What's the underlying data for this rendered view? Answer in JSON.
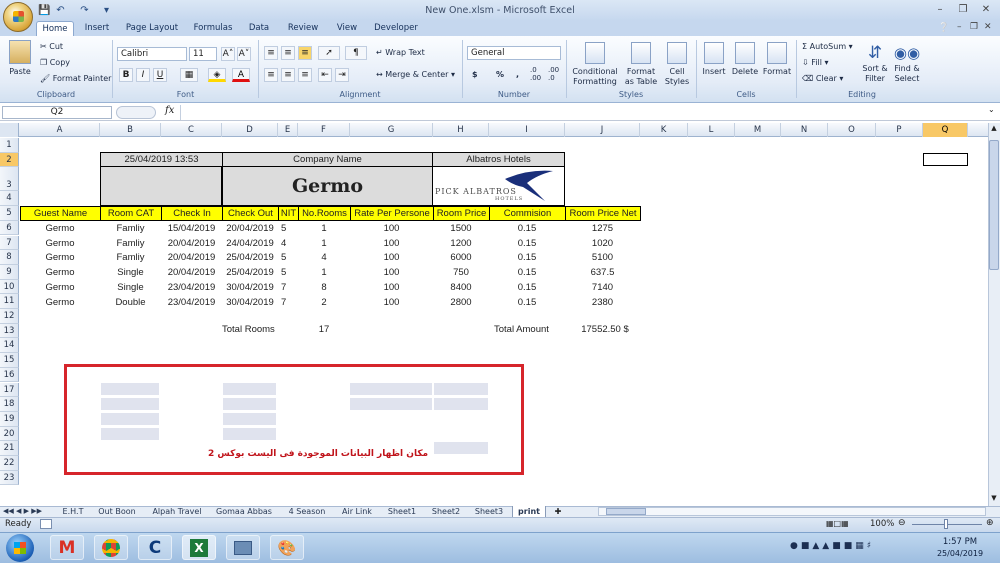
{
  "window": {
    "title": "New One.xlsm - Microsoft Excel"
  },
  "quick_access": [
    "save",
    "undo",
    "redo"
  ],
  "ribbon_tabs": [
    "Home",
    "Insert",
    "Page Layout",
    "Formulas",
    "Data",
    "Review",
    "View",
    "Developer"
  ],
  "ribbon": {
    "clipboard": {
      "label": "Clipboard",
      "paste": "Paste",
      "cut": "Cut",
      "copy": "Copy",
      "painter": "Format Painter"
    },
    "font": {
      "label": "Font",
      "name": "Calibri",
      "size": "11",
      "bold": "B",
      "italic": "I",
      "underline": "U",
      "grow": "A˄",
      "shrink": "A˅",
      "fontcolor": "A"
    },
    "alignment": {
      "label": "Alignment",
      "wrap": "Wrap Text",
      "merge": "Merge & Center"
    },
    "number": {
      "label": "Number",
      "format": "General",
      "currency": "$",
      "percent": "%",
      "comma": ",",
      "inc": ".0 .00",
      "dec": ".00 .0"
    },
    "styles": {
      "label": "Styles",
      "cond": "Conditional Formatting",
      "table": "Format as Table",
      "cell": "Cell Styles"
    },
    "cells": {
      "label": "Cells",
      "insert": "Insert",
      "delete": "Delete",
      "format": "Format"
    },
    "editing": {
      "label": "Editing",
      "autosum": "AutoSum",
      "fill": "Fill",
      "clear": "Clear",
      "sort": "Sort & Filter",
      "find": "Find & Select"
    }
  },
  "formula_bar": {
    "name_box": "Q2",
    "fx": "fx",
    "value": ""
  },
  "columns": [
    "A",
    "B",
    "C",
    "D",
    "E",
    "F",
    "G",
    "H",
    "I",
    "J",
    "K",
    "L",
    "M",
    "N",
    "O",
    "P",
    "Q"
  ],
  "selected_column": "Q",
  "rows": [
    "1",
    "2",
    "3",
    "4",
    "5",
    "6",
    "7",
    "8",
    "9",
    "10",
    "11",
    "12",
    "13",
    "14",
    "15",
    "16",
    "17",
    "18",
    "19",
    "20",
    "21",
    "22",
    "23"
  ],
  "selected_row": "2",
  "sheet": {
    "date": "25/04/2019 13:53",
    "company_label": "Company Name",
    "hotel_label": "Albatros Hotels",
    "company_name": "Germo",
    "logo_text": "PICK ALBATROS",
    "logo_sub": "HOTELS",
    "headers": [
      "Guest Name",
      "Room CAT",
      "Check In",
      "Check Out",
      "NIT",
      "No.Rooms",
      "Rate Per Persone",
      "Room Price",
      "Commision",
      "Room Price Net"
    ],
    "data": [
      [
        "Germo",
        "Famliy",
        "15/04/2019",
        "20/04/2019",
        "5",
        "1",
        "100",
        "1500",
        "0.15",
        "1275"
      ],
      [
        "Germo",
        "Famliy",
        "20/04/2019",
        "24/04/2019",
        "4",
        "1",
        "100",
        "1200",
        "0.15",
        "1020"
      ],
      [
        "Germo",
        "Famliy",
        "20/04/2019",
        "25/04/2019",
        "5",
        "4",
        "100",
        "6000",
        "0.15",
        "5100"
      ],
      [
        "Germo",
        "Single",
        "20/04/2019",
        "25/04/2019",
        "5",
        "1",
        "100",
        "750",
        "0.15",
        "637.5"
      ],
      [
        "Germo",
        "Single",
        "23/04/2019",
        "30/04/2019",
        "7",
        "8",
        "100",
        "8400",
        "0.15",
        "7140"
      ],
      [
        "Germo",
        "Double",
        "23/04/2019",
        "30/04/2019",
        "7",
        "2",
        "100",
        "2800",
        "0.15",
        "2380"
      ]
    ],
    "total_rooms_label": "Total Rooms",
    "total_rooms": "17",
    "total_amount_label": "Total Amount",
    "total_amount": "17552.50 $",
    "arabic_note": "مكان اظهار البيانات الموجودة فى اليست بوكس 2"
  },
  "sheet_tabs": [
    "E.H.T",
    "Out Boon",
    "Alpah Travel",
    "Gomaa Abbas",
    "4 Season",
    "Air Link",
    "Sheet1",
    "Sheet2",
    "Sheet3",
    "print"
  ],
  "active_sheet": "print",
  "status": {
    "ready": "Ready",
    "zoom": "100%"
  },
  "taskbar": {
    "time": "1:57 PM",
    "date": "25/04/2019"
  },
  "accent": {
    "selection": "#f8c866",
    "header_fill": "#ffff00",
    "border_red": "#d6252b",
    "ribbon_blue": "#c5d7ee"
  }
}
